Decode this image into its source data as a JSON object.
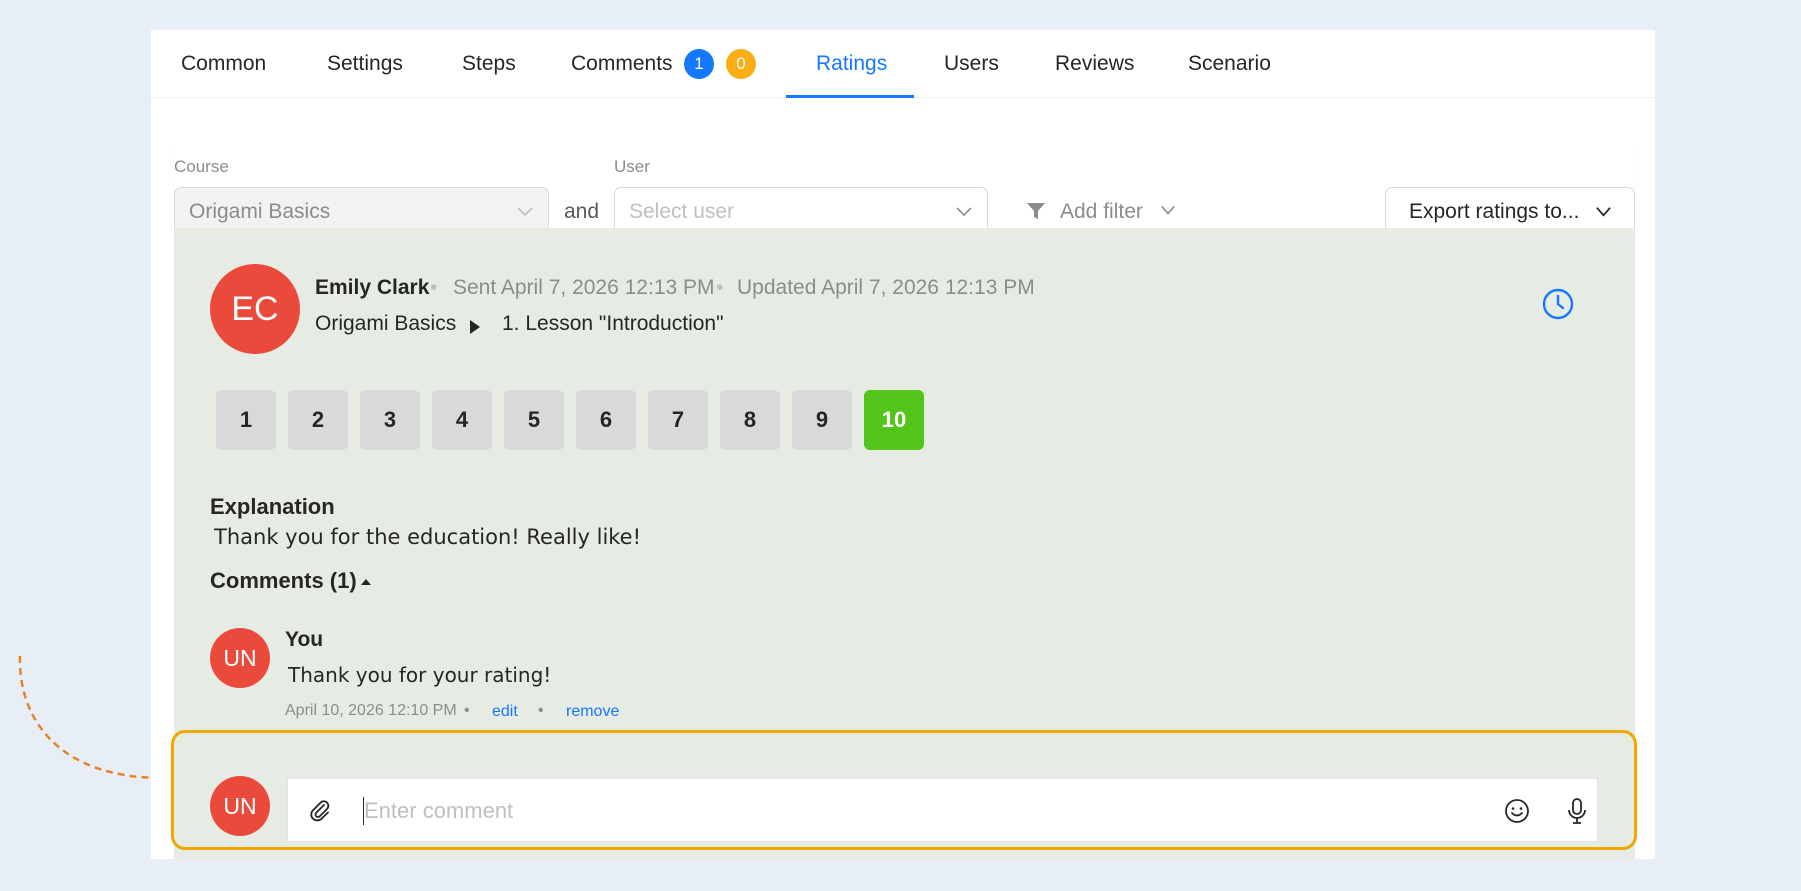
{
  "tabs": [
    {
      "label": "Common"
    },
    {
      "label": "Settings"
    },
    {
      "label": "Steps"
    },
    {
      "label": "Comments"
    },
    {
      "label": "Ratings"
    },
    {
      "label": "Users"
    },
    {
      "label": "Reviews"
    },
    {
      "label": "Scenario"
    }
  ],
  "comments_badges": {
    "blue": "1",
    "orange": "0"
  },
  "colors": {
    "accent": "#1677ff",
    "badge_orange": "#faad14",
    "selected_rating": "#52c41a",
    "avatar": "#ea4a3c",
    "highlight": "#f0a800"
  },
  "filters": {
    "course_label": "Course",
    "course_value": "Origami Basics",
    "and_text": "and",
    "user_label": "User",
    "user_placeholder": "Select user",
    "add_filter": "Add filter",
    "export": "Export ratings to..."
  },
  "rating": {
    "avatar_initials": "EC",
    "author": "Emily Clark",
    "sent": "Sent April 7, 2026 12:13 PM",
    "updated": "Updated April 7, 2026 12:13 PM",
    "course": "Origami Basics",
    "lesson": "1. Lesson \"Introduction\"",
    "scale": [
      "1",
      "2",
      "3",
      "4",
      "5",
      "6",
      "7",
      "8",
      "9",
      "10"
    ],
    "selected": 10,
    "explanation_title": "Explanation",
    "explanation_text": "Thank you for the education! Really like!",
    "comments_title": "Comments (1)"
  },
  "comment": {
    "avatar_initials": "UN",
    "author": "You",
    "text": "Thank you for your rating!",
    "date": "April 10, 2026 12:10 PM",
    "edit": "edit",
    "remove": "remove"
  },
  "composer": {
    "avatar_initials": "UN",
    "placeholder": "Enter comment"
  }
}
